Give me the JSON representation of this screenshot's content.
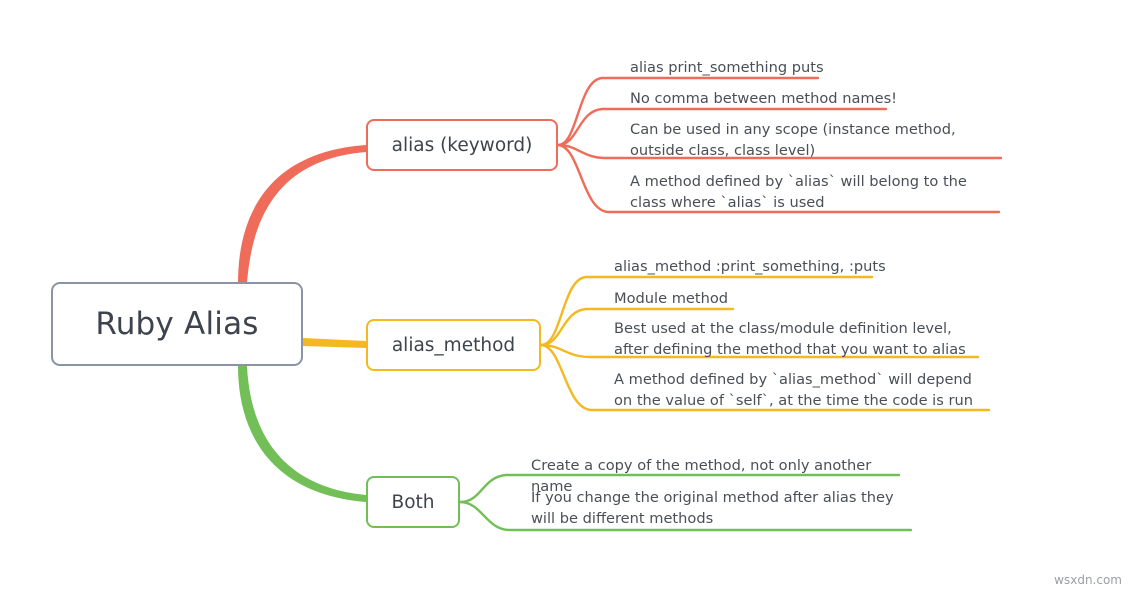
{
  "watermark": "wsxdn.com",
  "colors": {
    "root_border": "#8a94a6",
    "root_text": "#3d444d",
    "leaf_text": "#4a4f57",
    "branch_alias": "#ef6c5a",
    "branch_alias_method": "#f4b820",
    "branch_both": "#71bf56",
    "background": "#ffffff"
  },
  "mindmap": {
    "root": {
      "label": "Ruby Alias"
    },
    "branches": [
      {
        "label": "alias (keyword)",
        "color": "#ef6c5a",
        "leaves": [
          {
            "text": "alias print_something puts"
          },
          {
            "text": "No comma between method names!"
          },
          {
            "text": "Can be used in any scope (instance method, outside class, class level)"
          },
          {
            "text": "A method defined by `alias` will belong to the class where `alias` is used"
          }
        ]
      },
      {
        "label": "alias_method",
        "color": "#f4b820",
        "leaves": [
          {
            "text": "alias_method :print_something, :puts"
          },
          {
            "text": "Module method"
          },
          {
            "text": "Best used at the class/module definition level, after defining the method that you want to alias"
          },
          {
            "text": "A method defined by `alias_method` will depend on the value of `self`, at the time the code is run"
          }
        ]
      },
      {
        "label": "Both",
        "color": "#71bf56",
        "leaves": [
          {
            "text": "Create a copy of the method, not only another name"
          },
          {
            "text": "If you change the original method after alias they will be different methods"
          }
        ]
      }
    ]
  }
}
